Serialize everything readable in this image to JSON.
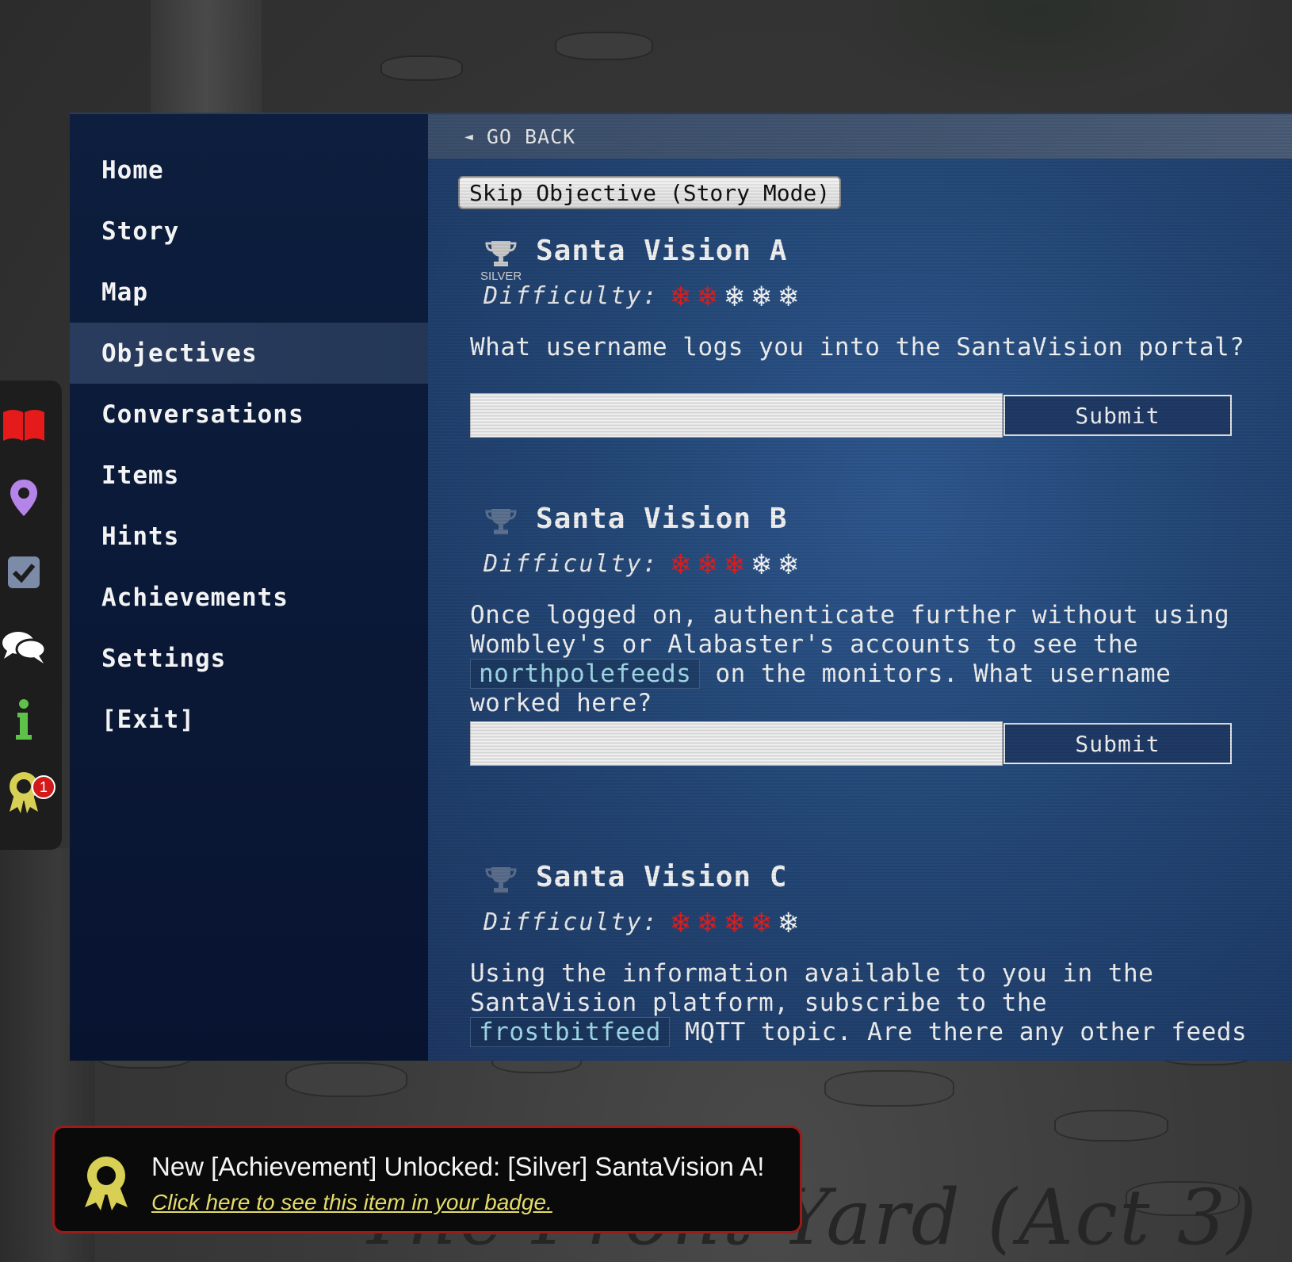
{
  "background": {
    "scene_title": "The Front Yard (Act 3)"
  },
  "iconbar": {
    "items": [
      {
        "icon": "book-icon",
        "color": "#e51b1b"
      },
      {
        "icon": "map-pin-icon",
        "color": "#b584e8"
      },
      {
        "icon": "checkbox-icon",
        "color": "#7c8ca8"
      },
      {
        "icon": "chat-bubbles-icon",
        "color": "#ffffff"
      },
      {
        "icon": "info-icon",
        "color": "#5ec24a"
      },
      {
        "icon": "badge-ribbon-icon",
        "color": "#d8cf55"
      }
    ],
    "badge_count": "1"
  },
  "sidebar": {
    "items": [
      {
        "label": "Home"
      },
      {
        "label": "Story"
      },
      {
        "label": "Map"
      },
      {
        "label": "Objectives",
        "active": true
      },
      {
        "label": "Conversations"
      },
      {
        "label": "Items"
      },
      {
        "label": "Hints"
      },
      {
        "label": "Achievements"
      },
      {
        "label": "Settings"
      },
      {
        "label": "[Exit]"
      }
    ]
  },
  "content": {
    "go_back_label": "GO BACK",
    "skip_label": "Skip Objective (Story Mode)",
    "difficulty_label": "Difficulty:",
    "submit_label": "Submit",
    "objectives": [
      {
        "title": "Santa Vision A",
        "trophy": "SILVER",
        "difficulty_level": 2,
        "difficulty_max": 5,
        "question": "What username logs you into the SantaVision portal?",
        "answer": ""
      },
      {
        "title": "Santa Vision B",
        "trophy": "",
        "difficulty_level": 3,
        "difficulty_max": 5,
        "question_part1": "Once logged on, authenticate further without using Wombley's or Alabaster's accounts to see the",
        "question_code": "northpolefeeds",
        "question_part2": "on the monitors. What username worked here?",
        "answer": ""
      },
      {
        "title": "Santa Vision C",
        "trophy": "",
        "difficulty_level": 4,
        "difficulty_max": 5,
        "question_part1": "Using the information available to you in the SantaVision platform, subscribe to the",
        "question_code": "frostbitfeed",
        "question_part2": "MQTT topic. Are there any other feeds"
      }
    ]
  },
  "toast": {
    "title": "New [Achievement] Unlocked: [Silver] SantaVision A!",
    "link": "Click here to see this item in your badge.",
    "border_color": "#a01818",
    "link_color": "#e4dc6a"
  }
}
